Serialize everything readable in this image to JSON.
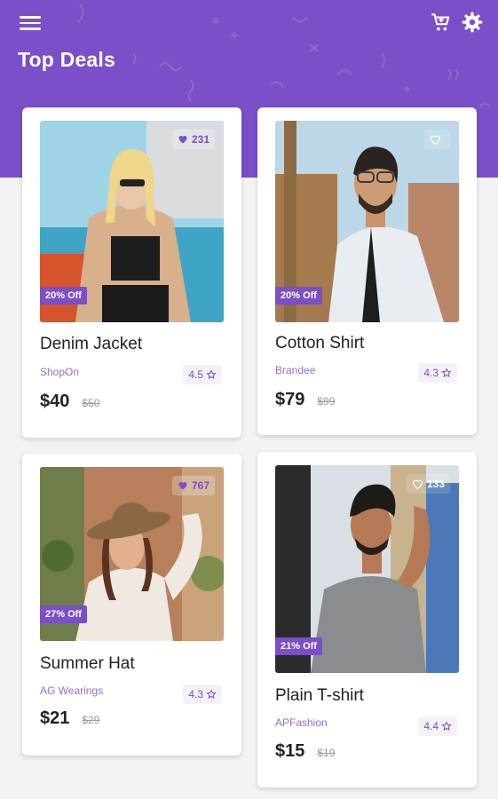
{
  "header": {
    "title": "Top Deals",
    "icons": [
      "menu-icon",
      "cart-icon",
      "settings-icon"
    ],
    "color": "#7a4fc8"
  },
  "products": [
    {
      "name": "Denim Jacket",
      "brand": "ShopOn",
      "price": "$40",
      "old_price": "$50",
      "discount": "20% Off",
      "rating": "4.5",
      "likes": "231",
      "liked": true
    },
    {
      "name": "Cotton Shirt",
      "brand": "Brandee",
      "price": "$79",
      "old_price": "$99",
      "discount": "20% Off",
      "rating": "4.3",
      "likes": "",
      "liked": false
    },
    {
      "name": "Summer Hat",
      "brand": "AG Wearings",
      "price": "$21",
      "old_price": "$29",
      "discount": "27% Off",
      "rating": "4.3",
      "likes": "767",
      "liked": true
    },
    {
      "name": "Plain T-shirt",
      "brand": "APFashion",
      "price": "$15",
      "old_price": "$19",
      "discount": "21% Off",
      "rating": "4.4",
      "likes": "133",
      "liked": false
    }
  ]
}
